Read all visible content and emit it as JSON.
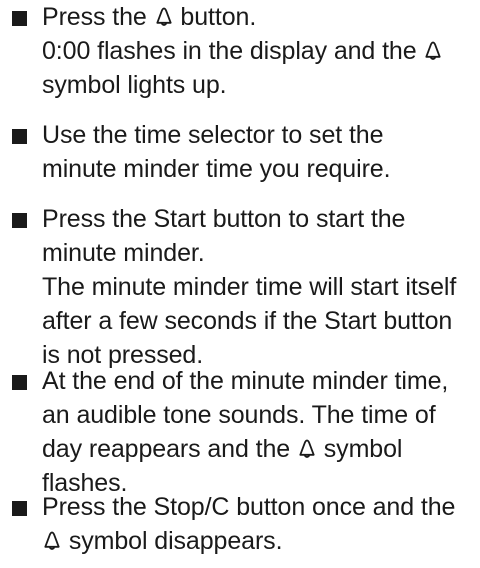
{
  "instructions": [
    {
      "lines": [
        {
          "before": "Press the ",
          "icon": "bell-icon",
          "after": " button."
        },
        {
          "before": "0:00 flashes in the display and the ",
          "icon": "bell-icon",
          "after": ""
        },
        {
          "before": "symbol lights up."
        }
      ]
    },
    {
      "lines": [
        {
          "before": "Use the time selector to set the"
        },
        {
          "before": "minute minder time you require."
        }
      ]
    },
    {
      "lines": [
        {
          "before": "Press the Start button to start the"
        },
        {
          "before": "minute minder."
        },
        {
          "before": "The minute minder time will start itself"
        },
        {
          "before": "after a few seconds if the Start button"
        },
        {
          "before": "is not pressed."
        }
      ]
    },
    {
      "lines": [
        {
          "before": "At the end of the minute minder time,"
        },
        {
          "before": "an audible tone sounds. The time of"
        },
        {
          "before": "day reappears and the ",
          "icon": "bell-icon",
          "after": " symbol"
        },
        {
          "before": "flashes."
        }
      ]
    },
    {
      "lines": [
        {
          "before": "Press the Stop/C button once and the"
        },
        {
          "before": "",
          "icon": "bell-icon",
          "after": " symbol disappears."
        }
      ]
    }
  ]
}
